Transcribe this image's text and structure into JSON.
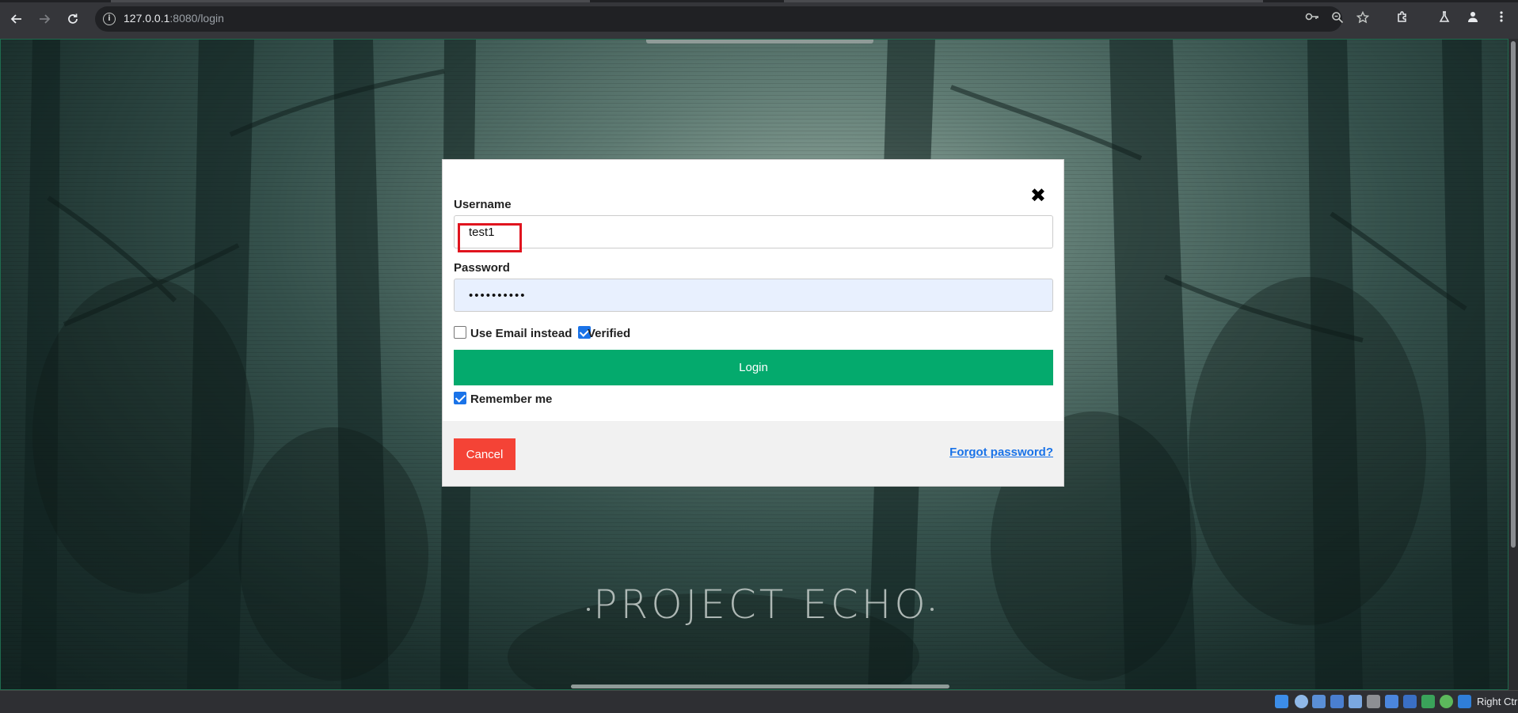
{
  "browser": {
    "url_host": "127.0.0.1",
    "url_rest": ":8080/login",
    "back_icon": "arrow-left-icon",
    "forward_icon": "arrow-right-icon",
    "reload_icon": "reload-icon"
  },
  "login_form": {
    "username_label": "Username",
    "username_value": "test1",
    "password_label": "Password",
    "password_value": "••••••••••",
    "use_email_label": "Use Email instead",
    "use_email_checked": false,
    "verified_label": "Verified",
    "verified_checked": true,
    "login_button": "Login",
    "remember_label": "Remember me",
    "remember_checked": true,
    "cancel_button": "Cancel",
    "forgot_link": "Forgot password?",
    "close_symbol": "✖"
  },
  "page": {
    "brand_title": "PROJECT ECHO"
  },
  "taskbar": {
    "host_key_label": "Right Ctrl"
  },
  "colors": {
    "login_button": "#04aa6d",
    "cancel_button": "#f44336",
    "highlight": "#e0141e",
    "link": "#1a73e8"
  }
}
